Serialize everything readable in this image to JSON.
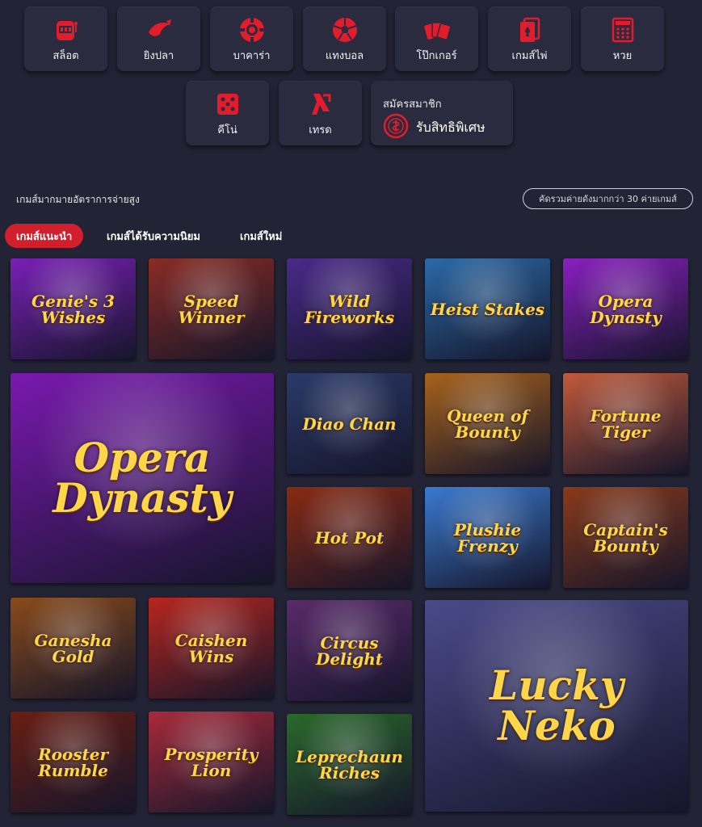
{
  "categories": [
    {
      "label": "สล็อต",
      "icon": "slot-machine-icon"
    },
    {
      "label": "ยิงปลา",
      "icon": "fish-icon"
    },
    {
      "label": "บาคาร่า",
      "icon": "poker-chip-icon"
    },
    {
      "label": "แทงบอล",
      "icon": "soccer-ball-icon"
    },
    {
      "label": "โป๊กเกอร์",
      "icon": "poker-cards-icon"
    },
    {
      "label": "เกมส์ไพ่",
      "icon": "playing-cards-icon"
    },
    {
      "label": "หวย",
      "icon": "lottery-ticket-icon"
    },
    {
      "label": "คีโน่",
      "icon": "dice-icon"
    },
    {
      "label": "เทรด",
      "icon": "trade-arrow-icon"
    }
  ],
  "signup": {
    "title": "สมัครสมาชิก",
    "cta": "รับสิทธิพิเศษ",
    "icon": "coin-icon"
  },
  "section": {
    "headline": "เกมส์มากมายอัตราการจ่ายสูง",
    "providers_pill": "คัดรวมค่ายดังมากกว่า 30 ค่ายเกมส์"
  },
  "tabs": [
    "เกมส์แนะนำ",
    "เกมส์ได้รับความนิยม",
    "เกมส์ใหม่"
  ],
  "games": [
    {
      "name": "Genie's 3 Wishes",
      "bg": "#7a1fb8"
    },
    {
      "name": "Speed Winner",
      "bg": "#8a2c24"
    },
    {
      "name": "Wild Fireworks",
      "bg": "#4a2a8a"
    },
    {
      "name": "Heist Stakes",
      "bg": "#2a6aa8"
    },
    {
      "name": "Opera Dynasty",
      "bg": "#8a1ec0"
    },
    {
      "name": "Opera Dynasty",
      "bg": "#7a18b0"
    },
    {
      "name": "Diao Chan",
      "bg": "#2a3a6a"
    },
    {
      "name": "Queen of Bounty",
      "bg": "#a8621a"
    },
    {
      "name": "Fortune Tiger",
      "bg": "#c25a3a"
    },
    {
      "name": "Hot Pot",
      "bg": "#8a2a12"
    },
    {
      "name": "Plushie Frenzy",
      "bg": "#3a7ad0"
    },
    {
      "name": "Captain's Bounty",
      "bg": "#8a3a1a"
    },
    {
      "name": "Ganesha Gold",
      "bg": "#8a4a1a"
    },
    {
      "name": "Caishen Wins",
      "bg": "#b8261e"
    },
    {
      "name": "Circus Delight",
      "bg": "#5a2a6a"
    },
    {
      "name": "Lucky Neko",
      "bg": "#4a4a8a"
    },
    {
      "name": "Rooster Rumble",
      "bg": "#6a1e12"
    },
    {
      "name": "Prosperity Lion",
      "bg": "#a82a3a"
    },
    {
      "name": "Leprechaun Riches",
      "bg": "#2a6a2a"
    }
  ]
}
